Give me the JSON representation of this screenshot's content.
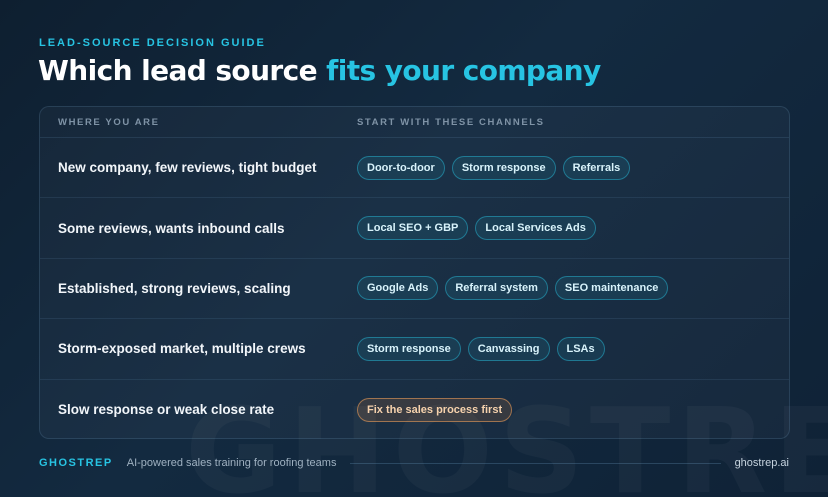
{
  "watermark": "GHOSTREP",
  "eyebrow": "LEAD-SOURCE DECISION GUIDE",
  "title": {
    "main": "Which lead source ",
    "accent": "fits your company"
  },
  "table": {
    "headers": {
      "left": "WHERE YOU ARE",
      "right": "START WITH THESE CHANNELS"
    },
    "rows": [
      {
        "situation": "New company, few reviews, tight budget",
        "channels": [
          "Door-to-door",
          "Storm response",
          "Referrals"
        ]
      },
      {
        "situation": "Some reviews, wants inbound calls",
        "channels": [
          "Local SEO + GBP",
          "Local Services Ads"
        ]
      },
      {
        "situation": "Established, strong reviews, scaling",
        "channels": [
          "Google Ads",
          "Referral system",
          "SEO maintenance"
        ]
      },
      {
        "situation": "Storm-exposed market, multiple crews",
        "channels": [
          "Storm response",
          "Canvassing",
          "LSAs"
        ]
      },
      {
        "situation": "Slow response or weak close rate",
        "channels": [
          "Fix the sales process first"
        ]
      }
    ]
  },
  "footer": {
    "brand": "GHOSTREP",
    "tagline": "AI-powered sales training for roofing teams",
    "site": "ghostrep.ai"
  },
  "colors": {
    "accent": "#27c4e3",
    "warning": "#e69b5a",
    "background": "#132a40"
  }
}
